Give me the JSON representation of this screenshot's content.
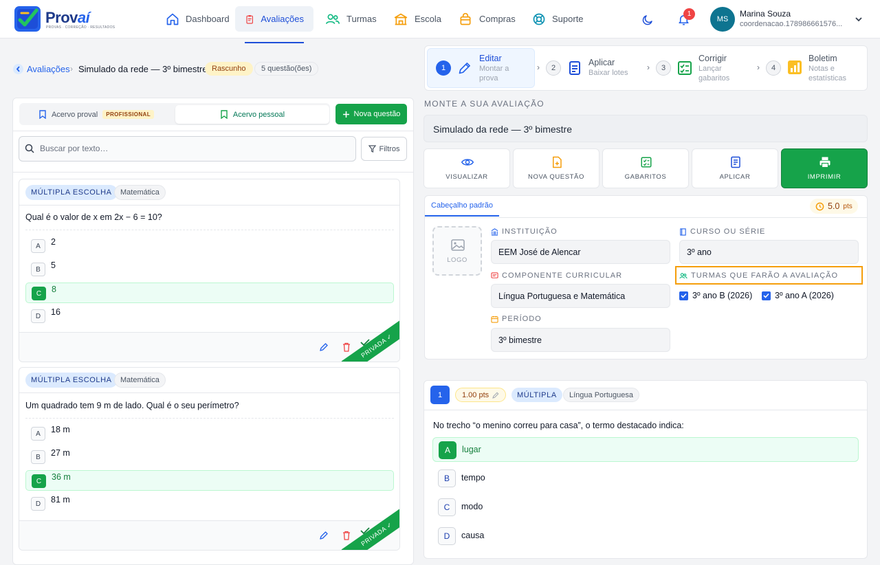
{
  "brand": {
    "name_a": "Prov",
    "name_b": "aí",
    "tagline": "PROVAS · CORREÇÃO · RESULTADOS"
  },
  "nav": [
    {
      "label": "Dashboard",
      "icon": "home-icon"
    },
    {
      "label": "Avaliações",
      "icon": "clipboard-icon",
      "active": true
    },
    {
      "label": "Turmas",
      "icon": "users-icon"
    },
    {
      "label": "Escola",
      "icon": "school-icon"
    },
    {
      "label": "Compras",
      "icon": "shopping-bag-icon"
    },
    {
      "label": "Suporte",
      "icon": "lifebuoy-icon"
    }
  ],
  "notifications": {
    "count": "1"
  },
  "user": {
    "initials": "MS",
    "name": "Marina Souza",
    "email": "coordenacao.178986661576..."
  },
  "breadcrumb": {
    "link": "Avaliações",
    "separator": "›",
    "current": "Simulado da rede — 3º bimestre",
    "status": "Rascunho",
    "questions": "5 questão(ões)"
  },
  "bank": {
    "tab_official": "Acervo proval",
    "tab_official_badge": "PROFISSIONAL",
    "tab_personal": "Acervo pessoal",
    "new_question": "Nova questão",
    "search_placeholder": "Buscar por texto…",
    "filters": "Filtros",
    "ribbon": "PRIVADA ✓",
    "questions": [
      {
        "type": "MÚLTIPLA ESCOLHA",
        "subject": "Matemática",
        "text": "Qual é o valor de x em 2x − 6 = 10?",
        "options": [
          {
            "letter": "A",
            "text": "2"
          },
          {
            "letter": "B",
            "text": "5"
          },
          {
            "letter": "C",
            "text": "8"
          },
          {
            "letter": "D",
            "text": "16"
          }
        ],
        "correct": 2
      },
      {
        "type": "MÚLTIPLA ESCOLHA",
        "subject": "Matemática",
        "text": "Um quadrado tem 9 m de lado. Qual é o seu perímetro?",
        "options": [
          {
            "letter": "A",
            "text": "18 m"
          },
          {
            "letter": "B",
            "text": "27 m"
          },
          {
            "letter": "C",
            "text": "36 m"
          },
          {
            "letter": "D",
            "text": "81 m"
          }
        ],
        "correct": 2
      }
    ]
  },
  "steps": [
    {
      "num": "1",
      "title": "Editar",
      "sub": "Montar a prova"
    },
    {
      "num": "2",
      "title": "Aplicar",
      "sub": "Baixar lotes"
    },
    {
      "num": "3",
      "title": "Corrigir",
      "sub": "Lançar gabaritos"
    },
    {
      "num": "4",
      "title": "Boletim",
      "sub": "Notas e estatísticas"
    }
  ],
  "builder": {
    "section_label": "MONTE A SUA AVALIAÇÃO",
    "title": "Simulado da rede — 3º bimestre",
    "actions": [
      "VISUALIZAR",
      "NOVA QUESTÃO",
      "GABARITOS",
      "APLICAR",
      "IMPRIMIR"
    ]
  },
  "header_form": {
    "tab": "Cabeçalho padrão",
    "points": "5.0",
    "points_unit": "pts",
    "logo": "LOGO",
    "institution_label": "INSTITUIÇÃO",
    "institution": "EEM José de Alencar",
    "course_label": "CURSO OU SÉRIE",
    "course": "3º ano",
    "component_label": "COMPONENTE CURRICULAR",
    "component": "Língua Portuguesa e Matemática",
    "classes_label": "TURMAS QUE FARÃO A AVALIAÇÃO",
    "classes": [
      "3º ano B (2026)",
      "3º ano A (2026)"
    ],
    "period_label": "PERÍODO",
    "period": "3º bimestre"
  },
  "question_block": {
    "num": "1",
    "points": "1.00 pts",
    "type": "MÚLTIPLA",
    "subject": "Língua Portuguesa",
    "text": "No trecho “o menino correu para casa”, o termo destacado indica:",
    "options": [
      {
        "letter": "A",
        "text": "lugar"
      },
      {
        "letter": "B",
        "text": "tempo"
      },
      {
        "letter": "C",
        "text": "modo"
      },
      {
        "letter": "D",
        "text": "causa"
      }
    ],
    "correct": 0
  },
  "colors": {
    "primary": "#2563eb",
    "success": "#16a34a",
    "warning": "#f59e0b"
  }
}
